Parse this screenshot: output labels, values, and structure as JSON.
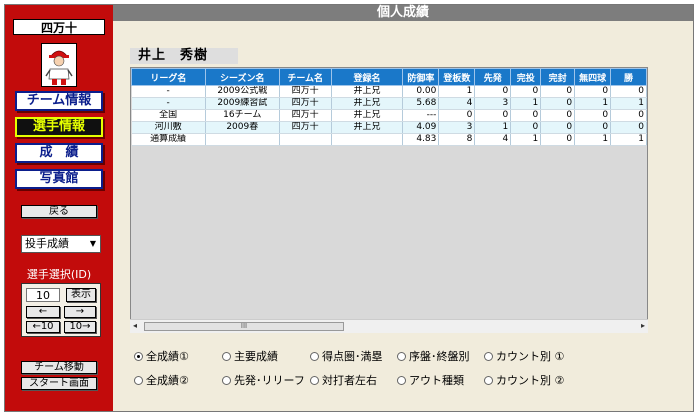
{
  "window": {
    "title": "個人成績"
  },
  "sidebar": {
    "team": "四万十",
    "nav": [
      {
        "label": "チーム情報",
        "active": false
      },
      {
        "label": "選手情報",
        "active": true
      },
      {
        "label": "成　績",
        "active": false
      },
      {
        "label": "写真館",
        "active": false
      }
    ],
    "back_label": "戻る",
    "category_select": "投手成績",
    "id_label": "選手選択(ID)",
    "id_value": "10",
    "show_label": "表示",
    "prev_label": "←",
    "next_label": "→",
    "prev10_label": "←10",
    "next10_label": "10→",
    "team_move_label": "チーム移動",
    "start_label": "スタート画面"
  },
  "player": {
    "name": "井上　秀樹"
  },
  "table": {
    "columns": [
      "リーグ名",
      "シーズン名",
      "チーム名",
      "登録名",
      "防御率",
      "登板数",
      "先発",
      "完投",
      "完封",
      "無四球",
      "勝"
    ],
    "rows": [
      [
        "-",
        "2009公式戦",
        "四万十",
        "井上兄",
        "0.00",
        "1",
        "0",
        "0",
        "0",
        "0",
        "0"
      ],
      [
        "-",
        "2009練習試",
        "四万十",
        "井上兄",
        "5.68",
        "4",
        "3",
        "1",
        "0",
        "1",
        "1"
      ],
      [
        "全国",
        "16チーム",
        "四万十",
        "井上兄",
        "---",
        "0",
        "0",
        "0",
        "0",
        "0",
        "0"
      ],
      [
        "河川敷",
        "2009春",
        "四万十",
        "井上兄",
        "4.09",
        "3",
        "1",
        "0",
        "0",
        "0",
        "0"
      ],
      [
        "通算成績",
        "",
        "",
        "",
        "4.83",
        "8",
        "4",
        "1",
        "0",
        "1",
        "1"
      ]
    ],
    "scroll_thumb": "III"
  },
  "radios": [
    {
      "label": "全成績①",
      "checked": true
    },
    {
      "label": "主要成績",
      "checked": false
    },
    {
      "label": "得点圏･満塁",
      "checked": false
    },
    {
      "label": "序盤･終盤別",
      "checked": false
    },
    {
      "label": "カウント別 ①",
      "checked": false
    },
    {
      "label": "全成績②",
      "checked": false
    },
    {
      "label": "先発･リリーフ",
      "checked": false
    },
    {
      "label": "対打者左右",
      "checked": false
    },
    {
      "label": "アウト種類",
      "checked": false
    },
    {
      "label": "カウント別 ②",
      "checked": false
    }
  ],
  "colors": {
    "sidebar": "#c20b0b",
    "header": "#1a78c9",
    "background": "#f1ecdc",
    "titlebar": "#7d7d7d"
  }
}
